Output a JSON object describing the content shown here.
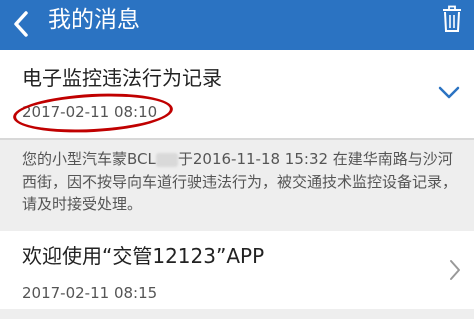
{
  "header": {
    "title": "我的消息",
    "back_icon": "chevron-left-icon",
    "trash_icon": "trash-icon"
  },
  "messages": [
    {
      "title": "电子监控违法行为记录",
      "date": "2017-02-11 08:10",
      "expanded": true,
      "expand_icon": "chevron-down-icon",
      "detail_prefix": "您的小型汽车蒙BCL",
      "detail_suffix": "于2016-11-18 15:32 在建华南路与沙河西街，因不按导向车道行驶违法行为，被交通技术监控设备记录，请及时接受处理。"
    },
    {
      "title": "欢迎使用“交管12123”APP",
      "date": "2017-02-11 08:15",
      "expanded": false,
      "expand_icon": "chevron-right-icon"
    }
  ],
  "colors": {
    "header": "#2b73c2",
    "annotation_circle": "#c00000"
  }
}
